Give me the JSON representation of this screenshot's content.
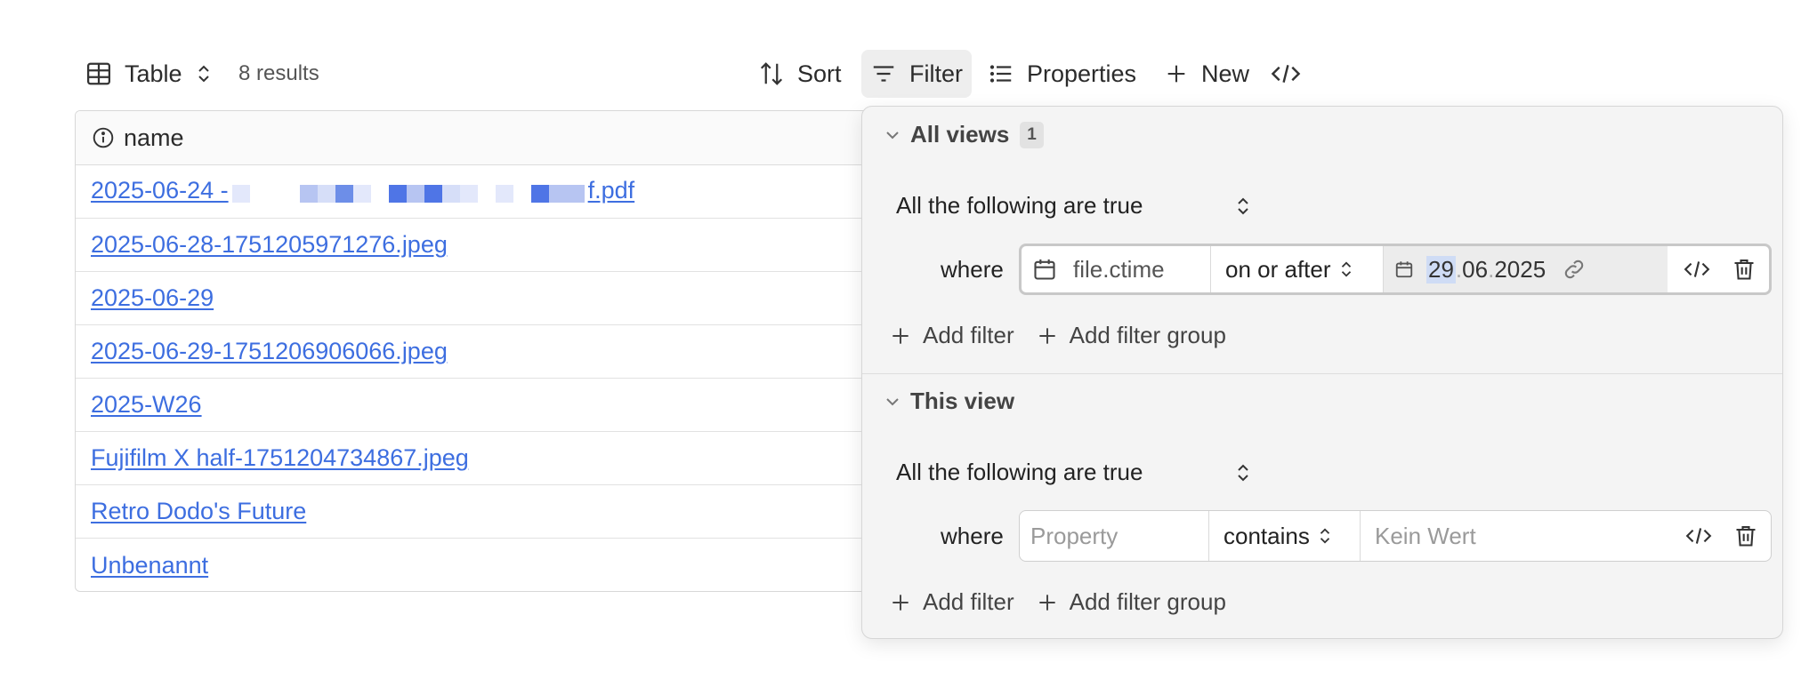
{
  "toolbar": {
    "view_label": "Table",
    "results": "8 results",
    "sort_label": "Sort",
    "filter_label": "Filter",
    "properties_label": "Properties",
    "new_label": "New"
  },
  "table": {
    "header": "name",
    "rows": [
      {
        "pre": "2025-06-24 -",
        "post": "f.pdf",
        "redacted": true
      },
      {
        "text": "2025-06-28-1751205971276.jpeg"
      },
      {
        "text": "2025-06-29"
      },
      {
        "text": "2025-06-29-1751206906066.jpeg"
      },
      {
        "text": "2025-W26"
      },
      {
        "text": "Fujifilm X half-1751204734867.jpeg"
      },
      {
        "text": "Retro Dodo's Future"
      },
      {
        "text": "Unbenannt"
      }
    ]
  },
  "filter_panel": {
    "all_views": {
      "title": "All views",
      "badge": "1",
      "conjunction": "All the following are true",
      "where": "where",
      "property": "file.ctime",
      "operator": "on or after",
      "date": {
        "day": "29",
        "month": "06",
        "year": "2025"
      },
      "add_filter": "Add filter",
      "add_group": "Add filter group"
    },
    "this_view": {
      "title": "This view",
      "conjunction": "All the following are true",
      "where": "where",
      "property_placeholder": "Property",
      "operator": "contains",
      "value_placeholder": "Kein Wert",
      "add_filter": "Add filter",
      "add_group": "Add filter group"
    }
  },
  "colors": {
    "link": "#3d6ee0",
    "redaction_dark": "#5b7fe6",
    "redaction_light": "#dbe3fb",
    "panel_bg": "#f4f4f4"
  },
  "icons": [
    "table-icon",
    "updown-chevron-icon",
    "sort-icon",
    "filter-icon",
    "list-icon",
    "plus-icon",
    "code-icon",
    "info-icon",
    "calendar-icon",
    "link-icon",
    "trash-icon",
    "chevron-down-icon"
  ]
}
